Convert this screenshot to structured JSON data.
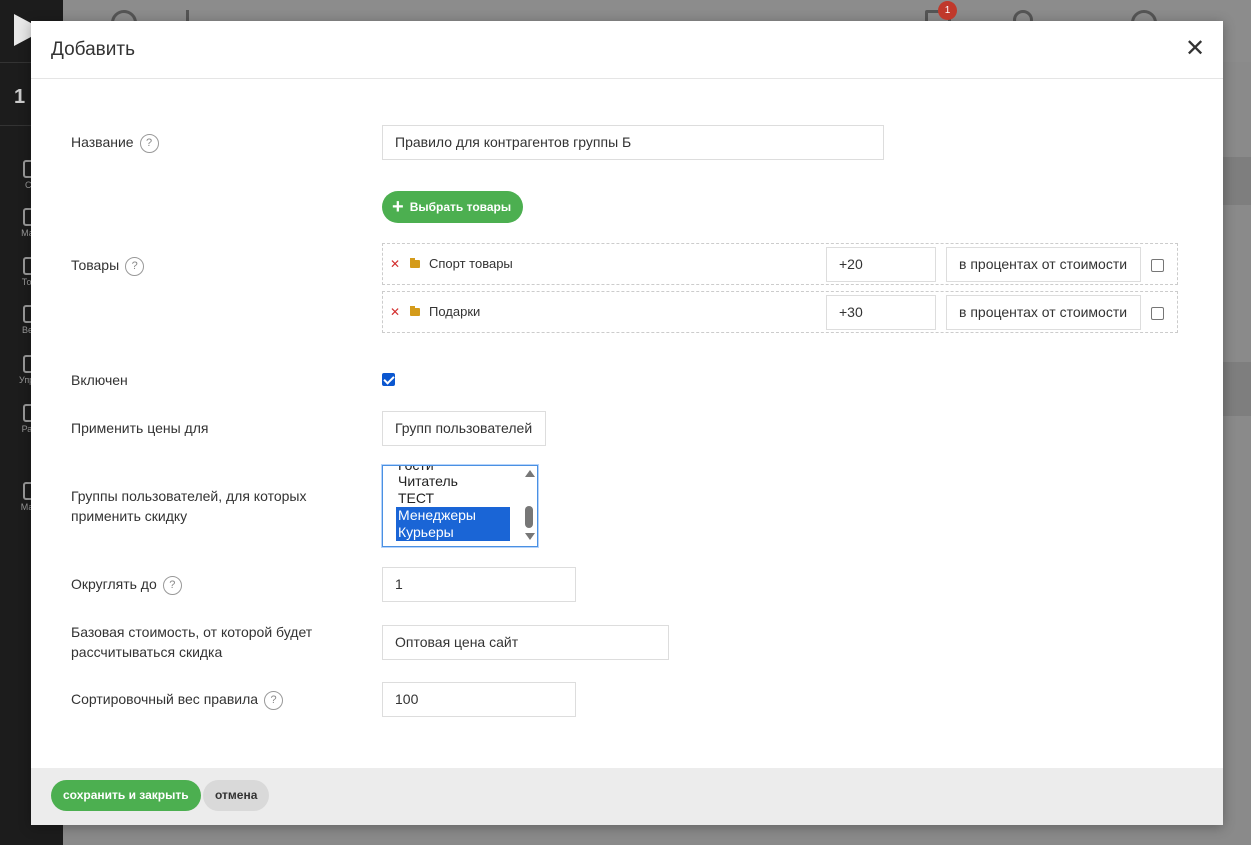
{
  "background": {
    "sidebar_number": "1",
    "nav": [
      "CR",
      "Мага",
      "Това",
      "Веб-",
      "Управ",
      "Разд",
      "Марк"
    ],
    "notification_count": "1"
  },
  "modal": {
    "title": "Добавить",
    "close_label": "✕",
    "fields": {
      "name": {
        "label": "Название",
        "value": "Правило для контрагентов группы Б"
      },
      "choose_products_label": "Выбрать товары",
      "products": {
        "label": "Товары",
        "items": [
          {
            "name": "Спорт товары",
            "value": "+20",
            "type": "в процентах от стоимости",
            "checked": false
          },
          {
            "name": "Подарки",
            "value": "+30",
            "type": "в процентах от стоимости",
            "checked": false
          }
        ]
      },
      "enabled": {
        "label": "Включен",
        "checked": true
      },
      "apply_prices_for": {
        "label": "Применить цены для",
        "value": "Групп пользователей"
      },
      "user_groups": {
        "label_line1": "Группы пользователей, для которых",
        "label_line2": "применить скидку",
        "options": [
          "Гости",
          "Читатель",
          "ТЕСТ",
          "Менеджеры",
          "Курьеры"
        ],
        "selected": [
          "Менеджеры",
          "Курьеры"
        ]
      },
      "round_to": {
        "label": "Округлять до",
        "value": "1"
      },
      "base_price": {
        "label_line1": "Базовая стоимость, от которой будет",
        "label_line2": "рассчитываться скидка",
        "value": "Оптовая цена сайт"
      },
      "sort_weight": {
        "label": "Сортировочный вес правила",
        "value": "100"
      }
    },
    "help_mark": "?",
    "footer": {
      "save_label": "сохранить и закрыть",
      "cancel_label": "отмена"
    }
  },
  "colors": {
    "accent_green": "#4caf50",
    "selection_blue": "#1a65d6",
    "remove_red": "#d32f2f",
    "folder": "#d49b1a"
  }
}
